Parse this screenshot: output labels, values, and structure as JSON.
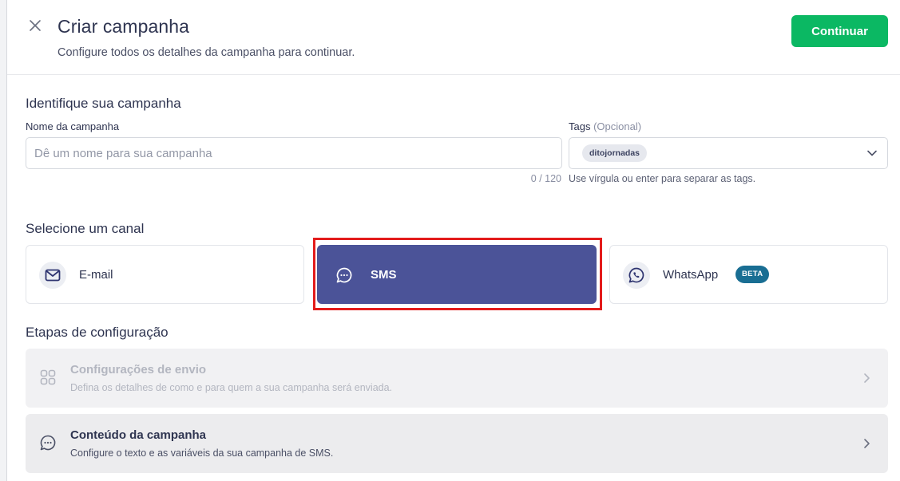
{
  "header": {
    "title": "Criar campanha",
    "subtitle": "Configure todos os detalhes da campanha para continuar.",
    "continue_label": "Continuar"
  },
  "identify": {
    "section_title": "Identifique sua campanha",
    "name_label": "Nome da campanha",
    "name_placeholder": "Dê um nome para sua campanha",
    "name_value": "",
    "char_counter": "0 / 120",
    "tags_label": "Tags",
    "tags_optional": "(Opcional)",
    "tags": [
      "ditojornadas"
    ],
    "tags_hint": "Use vírgula ou enter para separar as tags."
  },
  "channels": {
    "section_title": "Selecione um canal",
    "items": [
      {
        "label": "E-mail",
        "icon": "mail-icon",
        "selected": false
      },
      {
        "label": "SMS",
        "icon": "chat-bubble-icon",
        "selected": true
      },
      {
        "label": "WhatsApp",
        "icon": "whatsapp-icon",
        "selected": false,
        "badge": "BETA"
      }
    ]
  },
  "steps": {
    "section_title": "Etapas de configuração",
    "items": [
      {
        "title": "Configurações de envio",
        "description": "Defina os detalhes de como e para quem a sua campanha será enviada.",
        "icon": "grid-icon",
        "disabled": true
      },
      {
        "title": "Conteúdo da campanha",
        "description": "Configure o texto e as variáveis da sua campanha de SMS.",
        "icon": "chat-bubble-icon",
        "disabled": false
      }
    ]
  },
  "colors": {
    "primary_button": "#0bb863",
    "selected_channel": "#4b5398",
    "beta_badge": "#196e93",
    "highlight": "#e31b1b"
  }
}
